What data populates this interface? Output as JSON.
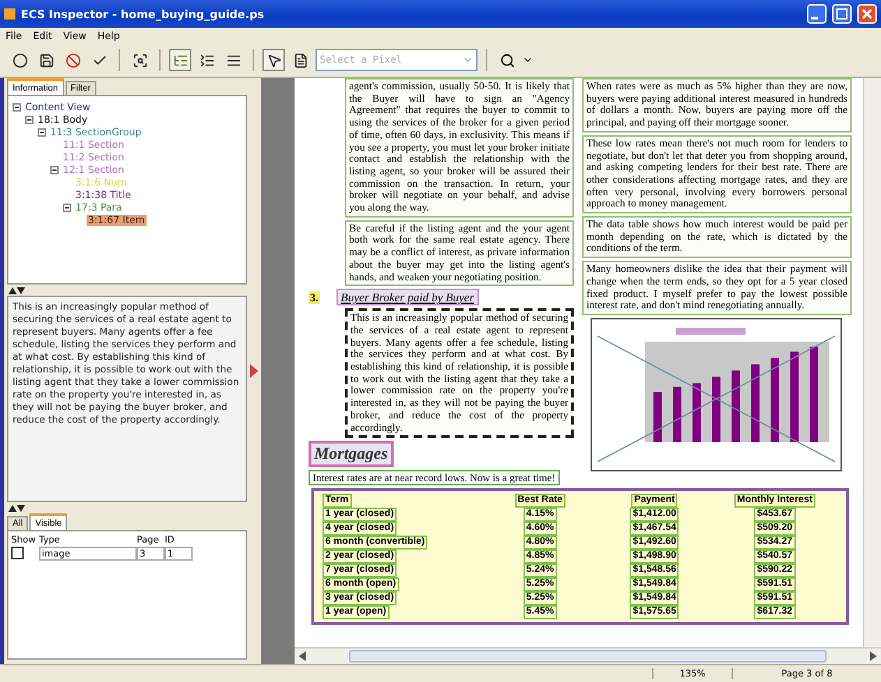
{
  "window": {
    "title": "ECS Inspector - home_buying_guide.ps"
  },
  "menu": [
    "File",
    "Edit",
    "View",
    "Help"
  ],
  "toolbar": {
    "commands": [
      {
        "kind": "circle"
      },
      {
        "kind": "save"
      },
      {
        "kind": "stop"
      },
      {
        "kind": "check"
      },
      {
        "kind": "find"
      }
    ],
    "view_modes": [
      {
        "kind": "tree_view",
        "selected": true
      },
      {
        "kind": "list_view",
        "selected": false
      },
      {
        "kind": "text_view",
        "selected": false
      }
    ],
    "tools": [
      {
        "kind": "pointer",
        "selected": true
      },
      {
        "kind": "page",
        "selected": false
      }
    ],
    "select_placeholder": "Select a Pixel"
  },
  "left_panel": {
    "tabs": [
      {
        "label": "Information",
        "selected": true
      },
      {
        "label": "Filter",
        "selected": false
      }
    ],
    "tree": [
      {
        "label": "Content View",
        "color": "#2a2aa0",
        "selected": false,
        "children": [
          {
            "label": "18:1 Body",
            "color": "#111111",
            "selected": false,
            "children": [
              {
                "label": "11:3 SectionGroup",
                "color": "#3a8a8a",
                "selected": false,
                "children": [
                  {
                    "label": "11:1 Section",
                    "color": "#b070c0",
                    "selected": false
                  },
                  {
                    "label": "11:2 Section",
                    "color": "#b070c0",
                    "selected": false
                  },
                  {
                    "label": "12:1 Section",
                    "color": "#b070c0",
                    "selected": false,
                    "children": [
                      {
                        "label": "3:1:6 Num",
                        "color": "#d8d840",
                        "selected": false
                      },
                      {
                        "label": "3:1:38 Title",
                        "color": "#8a2a8a",
                        "selected": false
                      },
                      {
                        "label": "17:3 Para",
                        "color": "#3a9a3a",
                        "selected": false,
                        "children": [
                          {
                            "label": "3:1:67 Item",
                            "color": "#e8a070",
                            "selected": true
                          }
                        ]
                      }
                    ]
                  }
                ]
              }
            ]
          }
        ]
      }
    ],
    "info_text": "This is an increasingly popular method of securing the services of a real estate agent to represent buyers. Many agents offer a fee schedule, listing the services they perform and at what cost. By establishing this kind of relationship, it is possible to work out with the listing agent that they take a lower commission rate on the property you're interested in, as they will not be paying the buyer broker, and reduce the cost of the property accordingly.",
    "list_tabs": [
      {
        "label": "All",
        "selected": false
      },
      {
        "label": "Visible",
        "selected": true
      }
    ],
    "list_columns": [
      "Show",
      "Type",
      "Page",
      "ID"
    ],
    "list_rows": [
      {
        "show": false,
        "type": "image",
        "page": "3",
        "id": "1"
      }
    ]
  },
  "document": {
    "left_column": [
      {
        "kind": "para",
        "text": "agent's commission, usually 50-50. It is likely that the Buyer will have to sign an \"Agency Agreement\" that requires the buyer to commit to using the services of the broker for a given period of time, often 60 days, in exclusivity. This means if you see a property, you must let your broker initiate contact and establish the relationship with the listing agent, so your broker will be assured their commission on the transaction. In return, your broker will negotiate on your behalf, and advise you along the way."
      },
      {
        "kind": "para",
        "text": "Be careful if the listing agent and the your agent both work for the same real estate agency. There may be a conflict of interest, as private information about the buyer may get into the listing agent's hands, and weaken your negotiating position."
      },
      {
        "kind": "numbered_heading",
        "num": "3.",
        "text": "Buyer Broker paid by Buyer"
      },
      {
        "kind": "selected_para",
        "text": "This is an increasingly popular method of securing the services of a real estate agent to represent buyers. Many agents offer a fee schedule, listing the services they perform and at what cost. By establishing this kind of relationship, it is possible to work out with the listing agent that they take a lower commission rate on the property you're interested in, as they will not be paying the buyer broker, and reduce the cost of the property accordingly."
      },
      {
        "kind": "title",
        "text": "Mortgages"
      },
      {
        "kind": "lead",
        "text": "Interest rates are at near record lows. Now is a great time!"
      }
    ],
    "right_column": [
      {
        "kind": "para",
        "text": "When rates were as much as 5% higher than they are now, buyers were paying additional interest measured in hundreds of dollars a month. Now, buyers are paying more off the principal, and paying off their mortgage sooner."
      },
      {
        "kind": "para",
        "text": "These low rates mean there's not much room for lenders to negotiate, but don't let that deter you from shopping around, and asking competing lenders for their best rate. There are other considerations affecting mortgage rates, and they are often very personal, involving every borrowers personal approach to money management."
      },
      {
        "kind": "para",
        "text": "The data table shows how much interest would be paid per month depending on the rate, which is dictated by the conditions of the term."
      },
      {
        "kind": "para",
        "text": "Many homeowners dislike the idea that their payment will change when the term ends, so they opt for a 5 year closed fixed product. I myself prefer to pay the lowest possible interest rate, and don't mind renegotiating annually."
      },
      {
        "kind": "chart"
      }
    ],
    "table": {
      "columns": [
        "Term",
        "Best Rate",
        "Payment",
        "Monthly Interest"
      ],
      "rows": [
        [
          "1 year (closed)",
          "4.15%",
          "$1,412.00",
          "$453.67"
        ],
        [
          "4 year (closed)",
          "4.60%",
          "$1,467.54",
          "$509.20"
        ],
        [
          "6 month (convertible)",
          "4.80%",
          "$1,492.60",
          "$534.27"
        ],
        [
          "2 year (closed)",
          "4.85%",
          "$1,498.90",
          "$540.57"
        ],
        [
          "7 year (closed)",
          "5.24%",
          "$1,548.56",
          "$590.22"
        ],
        [
          "6 month (open)",
          "5.25%",
          "$1,549.84",
          "$591.51"
        ],
        [
          "3 year (closed)",
          "5.25%",
          "$1,549.84",
          "$591.51"
        ],
        [
          "1 year (open)",
          "5.45%",
          "$1,575.65",
          "$617.32"
        ]
      ]
    }
  },
  "status_bar": {
    "zoom": "135%",
    "page": "Page 3 of 8"
  }
}
